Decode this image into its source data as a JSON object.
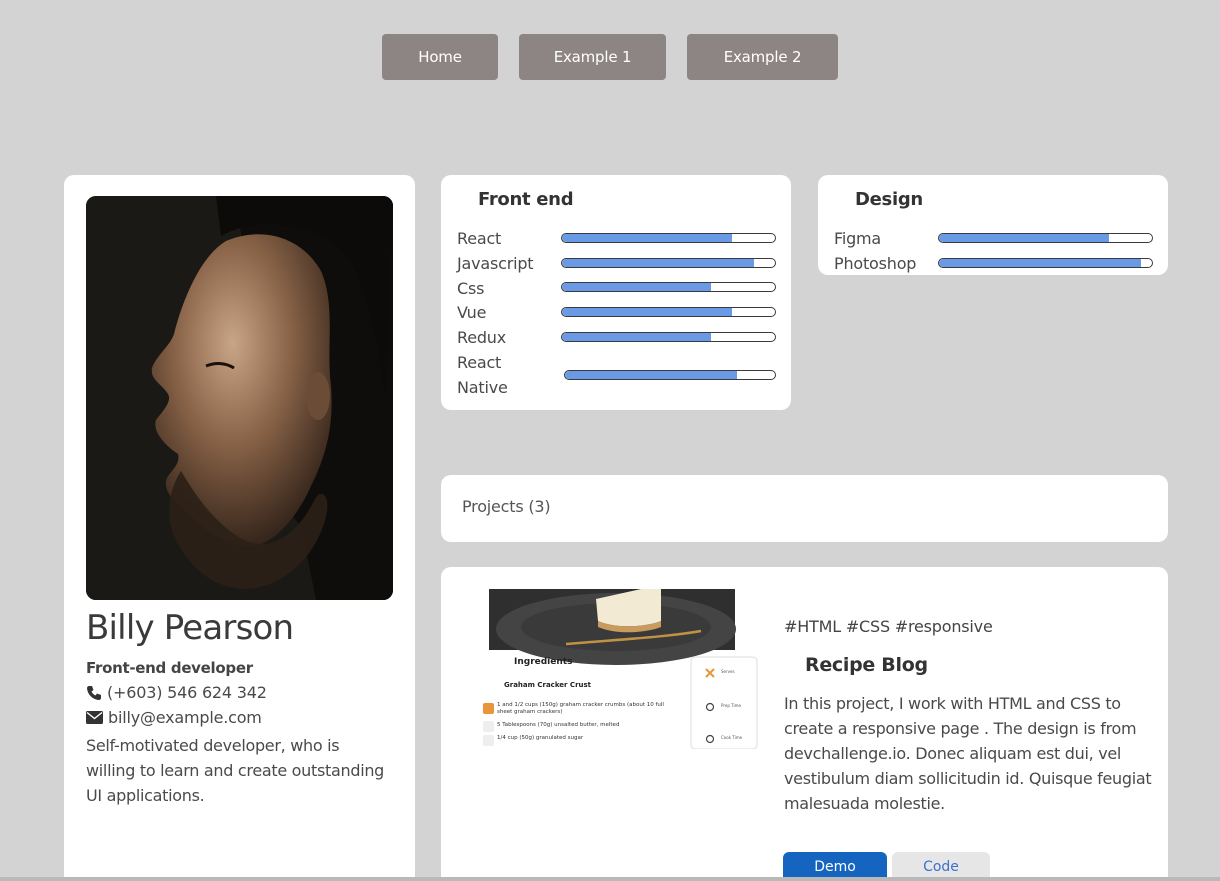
{
  "nav": {
    "items": [
      {
        "label": "Home"
      },
      {
        "label": "Example 1"
      },
      {
        "label": "Example 2"
      }
    ]
  },
  "profile": {
    "photo_icon": "portrait-photo",
    "name": "Billy Pearson",
    "role": "Front-end developer",
    "phone": "(+603) 546 624 342",
    "email": "billy@example.com",
    "bio": "Self-motivated developer, who is willing to learn and create outstanding UI applications."
  },
  "skills": {
    "frontend": {
      "title": "Front end",
      "items": [
        {
          "label": "React",
          "level": 0.8
        },
        {
          "label": "Javascript",
          "level": 0.9
        },
        {
          "label": "Css",
          "level": 0.7
        },
        {
          "label": "Vue",
          "level": 0.8
        },
        {
          "label": "Redux",
          "level": 0.7
        },
        {
          "label": "React Native",
          "level": 0.82
        }
      ]
    },
    "design": {
      "title": "Design",
      "items": [
        {
          "label": "Figma",
          "level": 0.8
        },
        {
          "label": "Photoshop",
          "level": 0.95
        }
      ]
    },
    "bar_color": "#6a9ae6"
  },
  "projects": {
    "header": "Projects (3)",
    "items": [
      {
        "tags": "#HTML #CSS #responsive",
        "title": "Recipe Blog",
        "description": "In this project, I work with HTML and CSS to create a responsive page . The design is from devchallenge.io. Donec aliquam est dui, vel vestibulum diam sollicitudin id. Quisque feugiat malesuada molestie.",
        "demo_label": "Demo",
        "code_label": "Code",
        "thumbnail": {
          "heading": "Ingredients",
          "subheading": "Graham Cracker Crust",
          "lines": [
            "1 and 1/2 cups (150g) graham cracker crumbs (about 10 full sheet graham crackers)",
            "5 Tablespoons (70g) unsalted butter, melted",
            "1/4 cup (50g) granulated sugar"
          ],
          "side": [
            "Serves",
            "Prep Time",
            "Cook Time"
          ]
        }
      }
    ]
  },
  "colors": {
    "background": "#d3d3d3",
    "nav_button": "#8d8484",
    "demo_button": "#1565c0",
    "code_text": "#3b6fd1"
  }
}
